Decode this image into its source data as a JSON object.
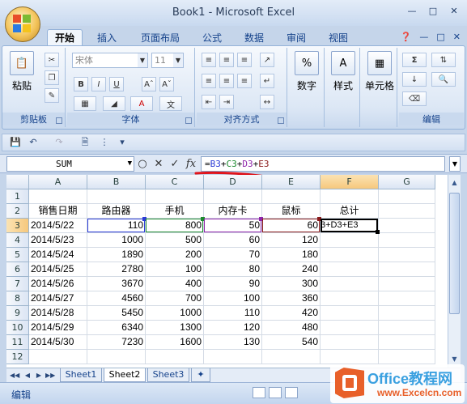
{
  "window": {
    "title": "Book1 - Microsoft Excel"
  },
  "tabs": [
    "开始",
    "插入",
    "页面布局",
    "公式",
    "数据",
    "审阅",
    "视图"
  ],
  "ribbon": {
    "clipboard": {
      "label": "剪贴板",
      "paste": "粘贴"
    },
    "font": {
      "label": "字体",
      "font_name": "宋体",
      "font_size": "11",
      "bold": "B",
      "italic": "I",
      "underline": "U"
    },
    "alignment": {
      "label": "对齐方式"
    },
    "number": {
      "label": "数字",
      "icon": "%"
    },
    "styles": {
      "label": "样式"
    },
    "cells": {
      "label": "单元格"
    },
    "editing": {
      "label": "编辑",
      "sum": "Σ"
    }
  },
  "formula_bar": {
    "name_box": "SUM",
    "fx": "fx",
    "formula_parts": [
      {
        "text": "=",
        "color": "#000000"
      },
      {
        "text": "B3",
        "color": "#2b3bd6"
      },
      {
        "text": "+",
        "color": "#000000"
      },
      {
        "text": "C3",
        "color": "#1c8a2e"
      },
      {
        "text": "+",
        "color": "#000000"
      },
      {
        "text": "D3",
        "color": "#8e24aa"
      },
      {
        "text": "+",
        "color": "#000000"
      },
      {
        "text": "E3",
        "color": "#8a1a1a"
      }
    ]
  },
  "sheet": {
    "columns": [
      "A",
      "B",
      "C",
      "D",
      "E",
      "F",
      "G"
    ],
    "rows": [
      "1",
      "2",
      "3",
      "4",
      "5",
      "6",
      "7",
      "8",
      "9",
      "10",
      "11",
      "12"
    ],
    "headers": [
      "销售日期",
      "路由器",
      "手机",
      "内存卡",
      "鼠标",
      "总计"
    ],
    "data": [
      [
        "2014/5/22",
        "110",
        "800",
        "50",
        "60",
        "3+D3+E3"
      ],
      [
        "2014/5/23",
        "1000",
        "500",
        "60",
        "120",
        ""
      ],
      [
        "2014/5/24",
        "1890",
        "200",
        "70",
        "180",
        ""
      ],
      [
        "2014/5/25",
        "2780",
        "100",
        "80",
        "240",
        ""
      ],
      [
        "2014/5/26",
        "3670",
        "400",
        "90",
        "300",
        ""
      ],
      [
        "2014/5/27",
        "4560",
        "700",
        "100",
        "360",
        ""
      ],
      [
        "2014/5/28",
        "5450",
        "1000",
        "110",
        "420",
        ""
      ],
      [
        "2014/5/29",
        "6340",
        "1300",
        "120",
        "480",
        ""
      ],
      [
        "2014/5/30",
        "7230",
        "1600",
        "130",
        "540",
        ""
      ]
    ],
    "tabs": [
      "Sheet1",
      "Sheet2",
      "Sheet3"
    ],
    "active_tab": "Sheet2"
  },
  "status": {
    "mode": "编辑"
  },
  "watermark": {
    "line1": "Office教程网",
    "line2": "www.Excelcn.com"
  }
}
